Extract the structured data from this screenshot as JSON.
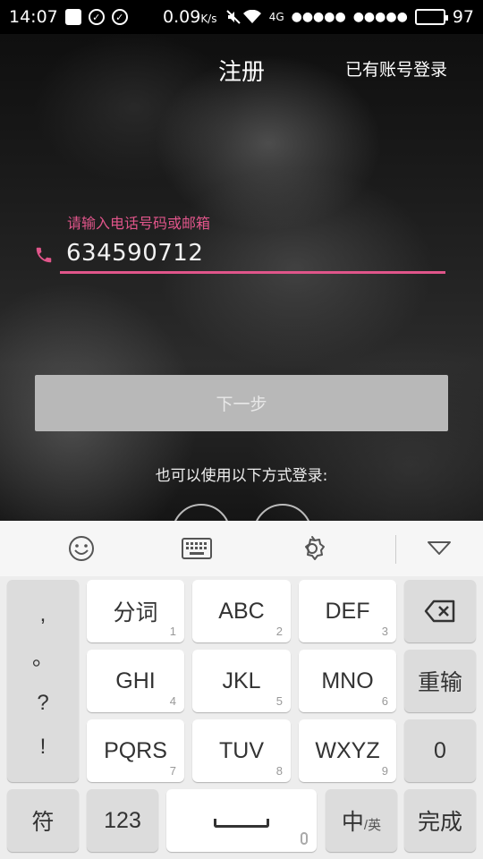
{
  "status_bar": {
    "time": "14:07",
    "speed": "0.09",
    "speed_unit": "K/s",
    "network": "4G",
    "signal1": "●●●●●",
    "signal2": "●●●●●",
    "battery": "97"
  },
  "header": {
    "title": "注册",
    "login_link": "已有账号登录"
  },
  "form": {
    "input_label": "请输入电话号码或邮箱",
    "input_value": "634590712",
    "next_button": "下一步",
    "other_login_text": "也可以使用以下方式登录:"
  },
  "colors": {
    "accent": "#e0558a",
    "button_disabled": "#b8b8b8",
    "keyboard_bg": "#ededed"
  },
  "keyboard": {
    "punct": [
      ",",
      "。",
      "?",
      "!"
    ],
    "row1": [
      {
        "label": "分词",
        "num": "1"
      },
      {
        "label": "ABC",
        "num": "2"
      },
      {
        "label": "DEF",
        "num": "3"
      }
    ],
    "row2": [
      {
        "label": "GHI",
        "num": "4"
      },
      {
        "label": "JKL",
        "num": "5"
      },
      {
        "label": "MNO",
        "num": "6"
      }
    ],
    "row3": [
      {
        "label": "PQRS",
        "num": "7"
      },
      {
        "label": "TUV",
        "num": "8"
      },
      {
        "label": "WXYZ",
        "num": "9"
      }
    ],
    "retype": "重输",
    "zero": "0",
    "symbols": "符",
    "numbers": "123",
    "lang_main": "中",
    "lang_sub": "/英",
    "done": "完成",
    "toolbar_icons": [
      "emoji-icon",
      "keyboard-icon",
      "gear-icon",
      "chevron-down-icon"
    ]
  }
}
